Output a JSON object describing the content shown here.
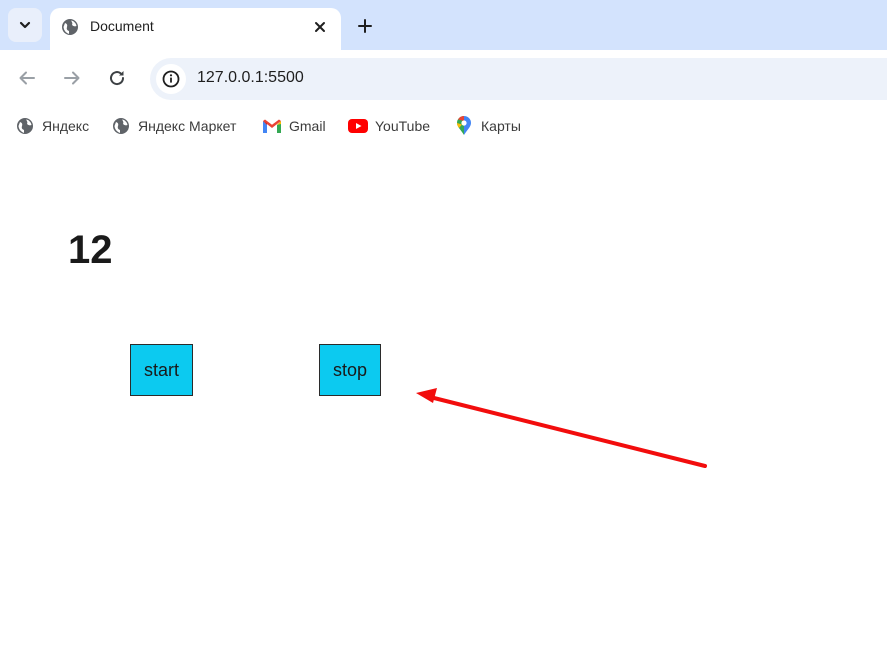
{
  "browser": {
    "tab": {
      "title": "Document"
    },
    "address_bar": {
      "url": "127.0.0.1:5500"
    },
    "bookmarks": [
      {
        "label": "Яндекс",
        "icon": "globe-icon"
      },
      {
        "label": "Яндекс Маркет",
        "icon": "globe-icon"
      },
      {
        "label": "Gmail",
        "icon": "gmail-icon"
      },
      {
        "label": "YouTube",
        "icon": "youtube-icon"
      },
      {
        "label": "Карты",
        "icon": "maps-pin-icon"
      }
    ]
  },
  "page": {
    "counter_value": "12",
    "buttons": {
      "start_label": "start",
      "stop_label": "stop"
    }
  },
  "colors": {
    "tabstrip_bg": "#d3e3fd",
    "button_bg": "#0ccaf0",
    "annotation_arrow": "#f20d0d"
  }
}
